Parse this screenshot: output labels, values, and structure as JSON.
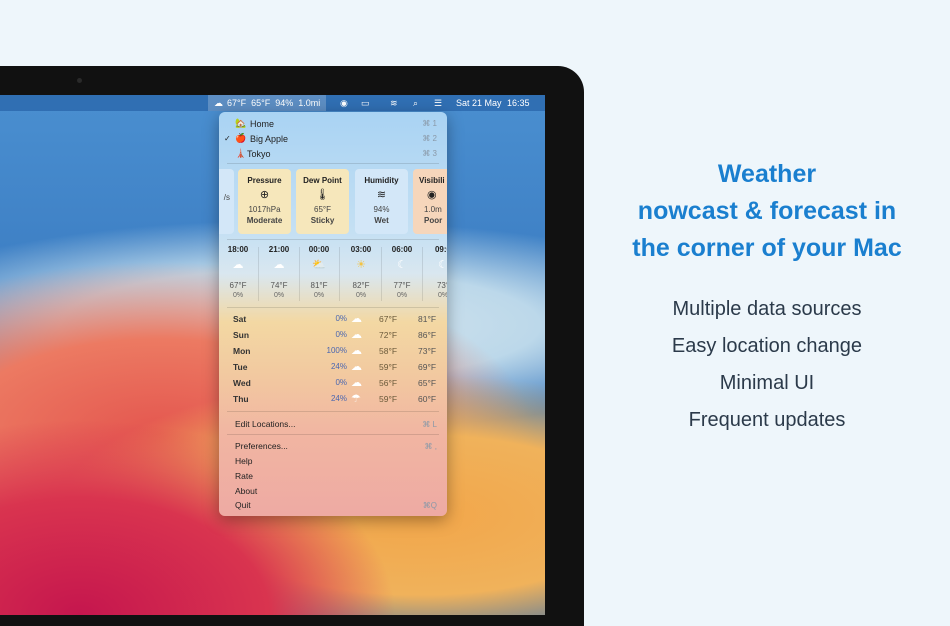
{
  "menubar": {
    "weather_summary": "67°F  65°F  94%  1.0mi",
    "date": "Sat 21 May",
    "time": "16:35"
  },
  "locations": [
    {
      "label": "Home",
      "emoji": "🏡",
      "shortcut": "⌘ 1",
      "checked": false
    },
    {
      "label": "Big Apple",
      "emoji": "🍎",
      "shortcut": "⌘ 2",
      "checked": true
    },
    {
      "label": "Tokyo",
      "emoji": "🗼",
      "shortcut": "⌘ 3",
      "checked": false
    }
  ],
  "cards": [
    {
      "title": "",
      "icon": "",
      "value": "/s",
      "status": "",
      "color": "#d3e7f8"
    },
    {
      "title": "Pressure",
      "icon": "gauge-icon",
      "value": "1017hPa",
      "status": "Moderate",
      "color": "#f6e7bb"
    },
    {
      "title": "Dew Point",
      "icon": "thermometer-icon",
      "value": "65°F",
      "status": "Sticky",
      "color": "#f6e7bb"
    },
    {
      "title": "Humidity",
      "icon": "humidity-icon",
      "value": "94%",
      "status": "Wet",
      "color": "#d3e7f8"
    },
    {
      "title": "Visibili",
      "icon": "eye-icon",
      "value": "1.0m",
      "status": "Poor",
      "color": "#f6d6bb"
    }
  ],
  "hourly": [
    {
      "time": "18:00",
      "icon": "cloud-icon",
      "temp": "67°F",
      "precip": "0%"
    },
    {
      "time": "21:00",
      "icon": "cloud-icon",
      "temp": "74°F",
      "precip": "0%"
    },
    {
      "time": "00:00",
      "icon": "partly-cloudy-icon",
      "temp": "81°F",
      "precip": "0%"
    },
    {
      "time": "03:00",
      "icon": "sun-icon",
      "temp": "82°F",
      "precip": "0%"
    },
    {
      "time": "06:00",
      "icon": "moon-icon",
      "temp": "77°F",
      "precip": "0%"
    },
    {
      "time": "09:0",
      "icon": "moon-icon",
      "temp": "73°",
      "precip": "0%"
    }
  ],
  "daily": [
    {
      "day": "Sat",
      "precip": "0%",
      "icon": "cloud-icon",
      "low": "67°F",
      "high": "81°F"
    },
    {
      "day": "Sun",
      "precip": "0%",
      "icon": "cloud-icon",
      "low": "72°F",
      "high": "86°F"
    },
    {
      "day": "Mon",
      "precip": "100%",
      "icon": "cloud-icon",
      "low": "58°F",
      "high": "73°F"
    },
    {
      "day": "Tue",
      "precip": "24%",
      "icon": "cloud-icon",
      "low": "59°F",
      "high": "69°F"
    },
    {
      "day": "Wed",
      "precip": "0%",
      "icon": "cloud-icon",
      "low": "56°F",
      "high": "65°F"
    },
    {
      "day": "Thu",
      "precip": "24%",
      "icon": "rain-icon",
      "low": "59°F",
      "high": "60°F"
    }
  ],
  "menu": {
    "edit_locations": "Edit Locations...",
    "edit_shortcut": "⌘ L",
    "preferences": "Preferences...",
    "pref_shortcut": "⌘ ,",
    "help": "Help",
    "rate": "Rate",
    "about": "About",
    "quit": "Quit",
    "quit_shortcut": "⌘Q"
  },
  "promo": {
    "headline": [
      "Weather",
      "nowcast & forecast in",
      "the corner of your Mac"
    ],
    "features": [
      "Multiple data sources",
      "Easy location change",
      "Minimal UI",
      "Frequent updates"
    ]
  },
  "colors": {
    "accent": "#1a7fcf",
    "background": "#eef6fb"
  }
}
